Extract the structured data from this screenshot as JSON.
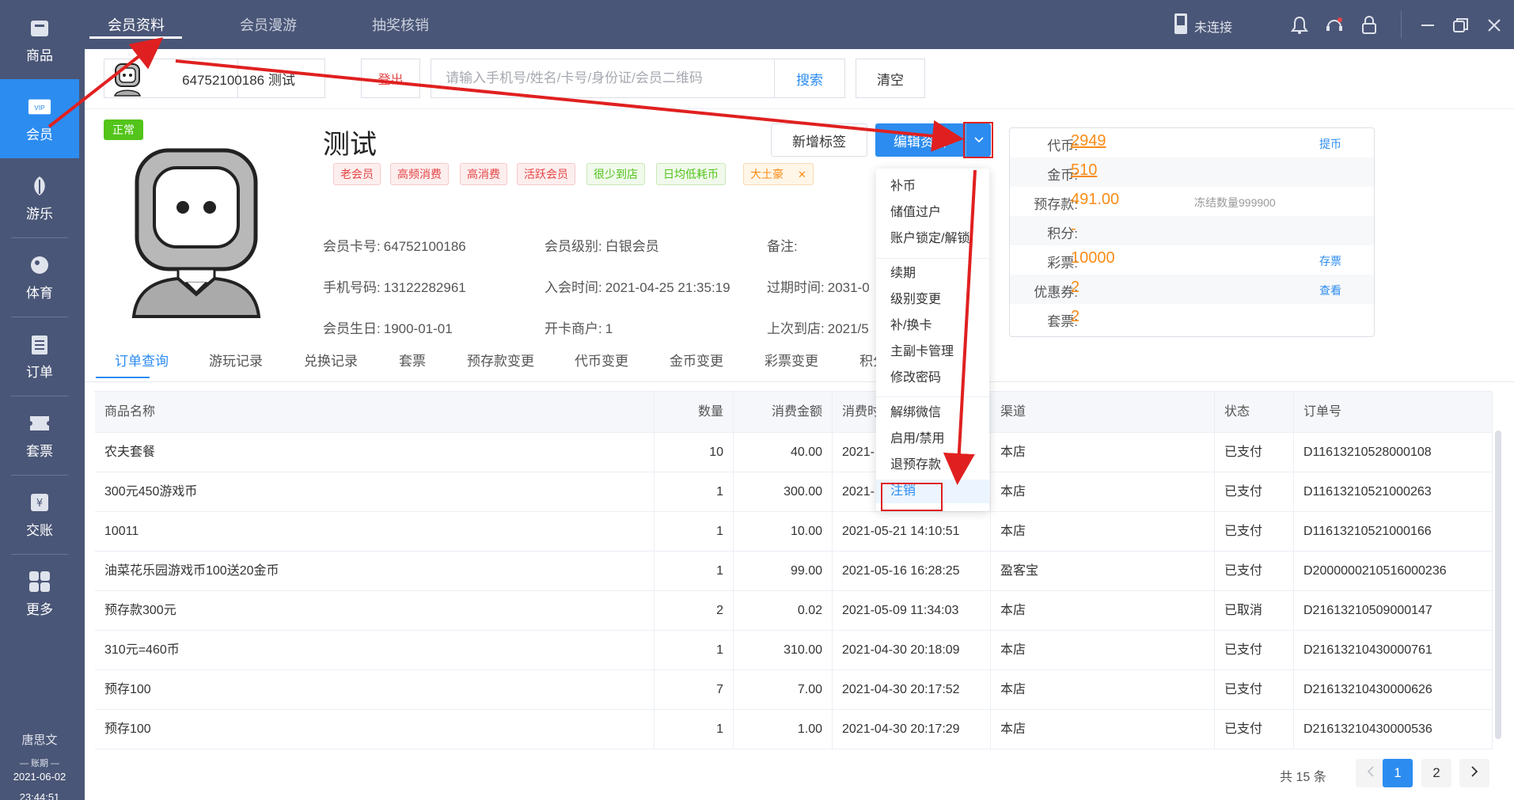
{
  "sidebar": {
    "items": [
      {
        "label": "商品",
        "icon": "bag-icon"
      },
      {
        "label": "会员",
        "icon": "vip-card-icon",
        "active": true
      },
      {
        "label": "游乐",
        "icon": "leaf-icon"
      },
      {
        "label": "体育",
        "icon": "ball-icon"
      },
      {
        "label": "订单",
        "icon": "clipboard-icon"
      },
      {
        "label": "套票",
        "icon": "ticket-icon"
      },
      {
        "label": "交账",
        "icon": "yen-icon"
      },
      {
        "label": "更多",
        "icon": "grid-icon"
      }
    ],
    "user": "唐思文",
    "period_label": "账期",
    "period_date": "2021-06-02",
    "time": "23:44:51"
  },
  "topbar": {
    "tabs": [
      "会员资料",
      "会员漫游",
      "抽奖核销"
    ],
    "active_tab": "会员资料",
    "connection": "未连接"
  },
  "member_strip": {
    "card_display": "64752100186  测试",
    "logout": "登出",
    "search_placeholder": "请输入手机号/姓名/卡号/身份证/会员二维码",
    "search_btn": "搜索",
    "clear_btn": "清空"
  },
  "profile": {
    "status": "正常",
    "name": "测试",
    "tags": [
      {
        "text": "老会员",
        "color": "red"
      },
      {
        "text": "高频消费",
        "color": "red"
      },
      {
        "text": "高消费",
        "color": "red"
      },
      {
        "text": "活跃会员",
        "color": "red"
      },
      {
        "text": "很少到店",
        "color": "green"
      },
      {
        "text": "日均低耗币",
        "color": "green"
      },
      {
        "text": "大土豪",
        "color": "orange"
      }
    ],
    "fields": {
      "card_no_label": "会员卡号:",
      "card_no": "64752100186",
      "level_label": "会员级别:",
      "level": "白银会员",
      "remark_label": "备注:",
      "phone_label": "手机号码:",
      "phone": "13122282961",
      "join_label": "入会时间:",
      "join": "2021-04-25 21:35:19",
      "expire_label": "过期时间:",
      "expire": "2031-0",
      "birthday_label": "会员生日:",
      "birthday": "1900-01-01",
      "merchant_label": "开卡商户:",
      "merchant": "1",
      "last_visit_label": "上次到店:",
      "last_visit": "2021/5"
    },
    "add_tag_btn": "新增标签",
    "edit_btn": "编辑资料"
  },
  "dropdown": {
    "groups": [
      [
        "补币",
        "储值过户",
        "账户锁定/解锁"
      ],
      [
        "续期",
        "级别变更",
        "补/换卡",
        "主副卡管理",
        "修改密码"
      ],
      [
        "解绑微信",
        "启用/禁用",
        "退预存款",
        "注销"
      ]
    ],
    "selected": "注销"
  },
  "balance": {
    "rows": [
      {
        "label": "代币:",
        "value": "2949",
        "link": "提币",
        "underline": true
      },
      {
        "label": "金币:",
        "value": "510",
        "underline": true
      },
      {
        "label": "预存款:",
        "value": "491.00",
        "note": "冻结数量999900"
      },
      {
        "label": "积分:",
        "value": "-"
      },
      {
        "label": "彩票:",
        "value": "10000",
        "link": "存票"
      },
      {
        "label": "优惠券:",
        "value": "2",
        "link": "查看"
      },
      {
        "label": "套票:",
        "value": "2"
      }
    ]
  },
  "tabs": [
    "订单查询",
    "游玩记录",
    "兑换记录",
    "套票",
    "预存款变更",
    "代币变更",
    "金币变更",
    "彩票变更",
    "积分"
  ],
  "table": {
    "headers": [
      "商品名称",
      "数量",
      "消费金额",
      "消费时",
      "渠道",
      "状态",
      "订单号"
    ],
    "rows": [
      [
        "农夫套餐",
        "10",
        "40.00",
        "2021-",
        "本店",
        "已支付",
        "D11613210528000108"
      ],
      [
        "300元450游戏币",
        "1",
        "300.00",
        "2021-",
        "本店",
        "已支付",
        "D11613210521000263"
      ],
      [
        "10011",
        "1",
        "10.00",
        "2021-05-21 14:10:51",
        "本店",
        "已支付",
        "D11613210521000166"
      ],
      [
        "油菜花乐园游戏币100送20金币",
        "1",
        "99.00",
        "2021-05-16 16:28:25",
        "盈客宝",
        "已支付",
        "D2000000210516000236"
      ],
      [
        "预存款300元",
        "2",
        "0.02",
        "2021-05-09 11:34:03",
        "本店",
        "已取消",
        "D21613210509000147"
      ],
      [
        "310元=460币",
        "1",
        "310.00",
        "2021-04-30 20:18:09",
        "本店",
        "已支付",
        "D21613210430000761"
      ],
      [
        "预存100",
        "7",
        "7.00",
        "2021-04-30 20:17:52",
        "本店",
        "已支付",
        "D21613210430000626"
      ],
      [
        "预存100",
        "1",
        "1.00",
        "2021-04-30 20:17:29",
        "本店",
        "已支付",
        "D21613210430000536"
      ]
    ]
  },
  "pagination": {
    "total": "共 15 条",
    "pages": [
      "1",
      "2"
    ],
    "current": "1"
  },
  "colors": {
    "accent": "#2c8cf0",
    "sidebar": "#4a5677",
    "annotation": "#e02020",
    "orange": "#fa8c16"
  }
}
